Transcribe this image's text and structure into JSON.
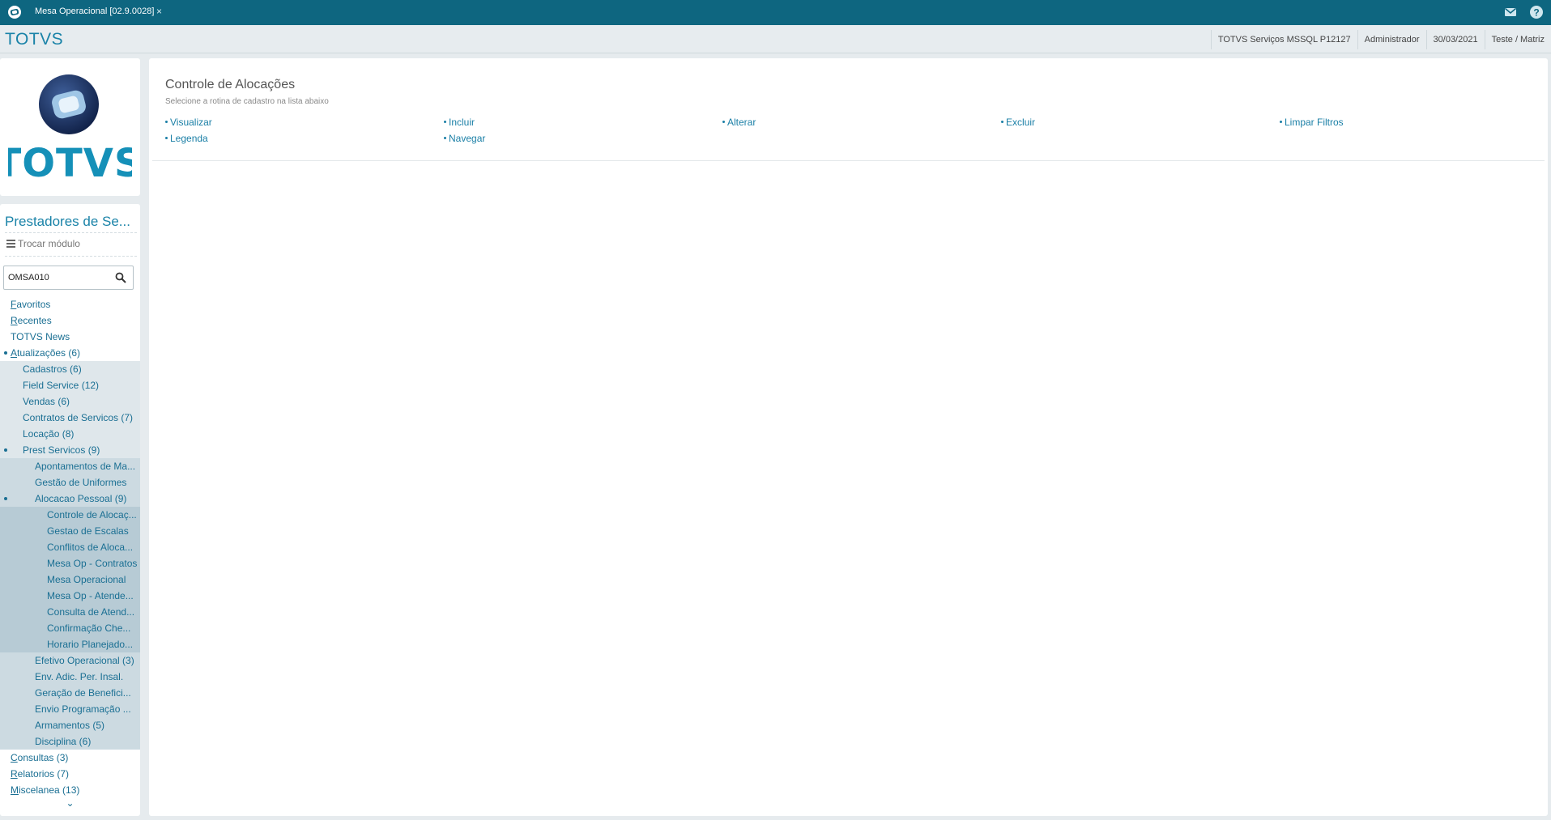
{
  "titlebar": {
    "tab_title": "Mesa Operacional [02.9.0028]",
    "tab_close": "×"
  },
  "header": {
    "brand": "TOTVS",
    "server": "TOTVS Serviços MSSQL P12127",
    "user": "Administrador",
    "date": "30/03/2021",
    "branch": "Teste / Matriz"
  },
  "logo": {
    "text": "TOTVS"
  },
  "sidebar": {
    "module_title": "Prestadores de Se...",
    "switch_module": "Trocar módulo",
    "search": {
      "value": "OMSA010",
      "placeholder": ""
    },
    "items": [
      {
        "label": "Favoritos",
        "level": 0,
        "accel": "F",
        "rest": "avoritos"
      },
      {
        "label": "Recentes",
        "level": 0,
        "accel": "R",
        "rest": "ecentes"
      },
      {
        "label": "TOTVS News",
        "level": 0,
        "accel": "",
        "rest": "TOTVS News"
      },
      {
        "label": "Atualizações (6)",
        "level": 0,
        "accel": "A",
        "rest": "tualizações (6)",
        "expanded": true
      },
      {
        "label": "Cadastros (6)",
        "level": 1
      },
      {
        "label": "Field Service (12)",
        "level": 1
      },
      {
        "label": "Vendas (6)",
        "level": 1
      },
      {
        "label": "Contratos de Servicos (7)",
        "level": 1
      },
      {
        "label": "Locação (8)",
        "level": 1
      },
      {
        "label": "Prest Servicos (9)",
        "level": 1,
        "expanded": true
      },
      {
        "label": "Apontamentos de Ma...",
        "level": 2
      },
      {
        "label": "Gestão de Uniformes",
        "level": 2
      },
      {
        "label": "Alocacao Pessoal (9)",
        "level": 2,
        "expanded": true
      },
      {
        "label": "Controle de Alocaç...",
        "level": 3
      },
      {
        "label": "Gestao de Escalas",
        "level": 3
      },
      {
        "label": "Conflitos de Aloca...",
        "level": 3
      },
      {
        "label": "Mesa Op - Contratos",
        "level": 3
      },
      {
        "label": "Mesa Operacional",
        "level": 3
      },
      {
        "label": "Mesa Op - Atende...",
        "level": 3
      },
      {
        "label": "Consulta de Atend...",
        "level": 3
      },
      {
        "label": "Confirmação Che...",
        "level": 3
      },
      {
        "label": "Horario Planejado...",
        "level": 3
      },
      {
        "label": "Efetivo Operacional (3)",
        "level": 2
      },
      {
        "label": "Env. Adic. Per. Insal.",
        "level": 2
      },
      {
        "label": "Geração de Benefici...",
        "level": 2
      },
      {
        "label": "Envio Programação ...",
        "level": 2
      },
      {
        "label": "Armamentos (5)",
        "level": 2
      },
      {
        "label": "Disciplina (6)",
        "level": 2
      },
      {
        "label": "Consultas (3)",
        "level": 0,
        "accel": "C",
        "rest": "onsultas (3)"
      },
      {
        "label": "Relatorios (7)",
        "level": 0,
        "accel": "R",
        "rest": "elatorios (7)"
      },
      {
        "label": "Miscelanea (13)",
        "level": 0,
        "accel": "M",
        "rest": "iscelanea (13)"
      }
    ],
    "more": "⌄"
  },
  "main": {
    "title": "Controle de Alocações",
    "subtitle": "Selecione a rotina de cadastro na lista abaixo",
    "actions": [
      "Visualizar",
      "Incluir",
      "Alterar",
      "Excluir",
      "Limpar Filtros",
      "Legenda",
      "Navegar"
    ]
  },
  "colors": {
    "titlebar": "#0e6680",
    "brand": "#1a83a8",
    "link": "#1a7fa6"
  }
}
